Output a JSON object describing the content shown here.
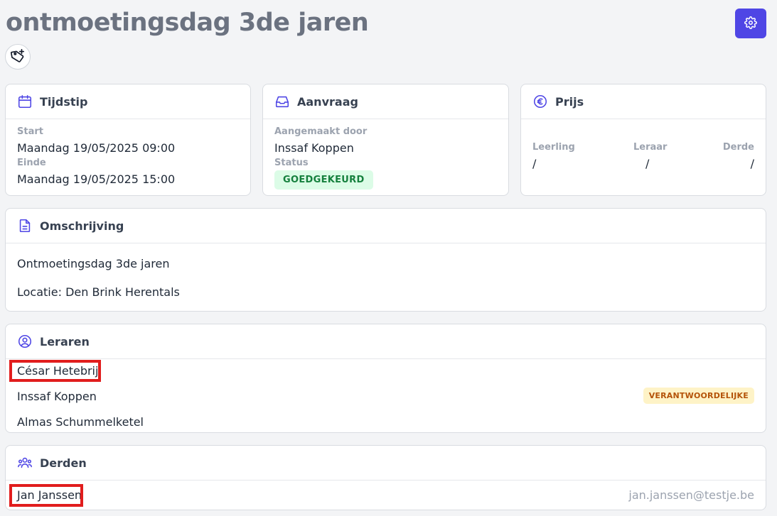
{
  "page": {
    "title": "ontmoetingsdag 3de jaren"
  },
  "tijdstip": {
    "title": "Tijdstip",
    "start_label": "Start",
    "start_value": "Maandag 19/05/2025 09:00",
    "end_label": "Einde",
    "end_value": "Maandag 19/05/2025 15:00"
  },
  "aanvraag": {
    "title": "Aanvraag",
    "created_by_label": "Aangemaakt door",
    "created_by_value": "Inssaf Koppen",
    "status_label": "Status",
    "status_value": "GOEDGEKEURD"
  },
  "prijs": {
    "title": "Prijs",
    "columns": [
      {
        "label": "Leerling",
        "value": "/"
      },
      {
        "label": "Leraar",
        "value": "/"
      },
      {
        "label": "Derde",
        "value": "/"
      }
    ]
  },
  "omschrijving": {
    "title": "Omschrijving",
    "lines": [
      "Ontmoetingsdag 3de jaren",
      "Locatie: Den Brink Herentals"
    ]
  },
  "leraren": {
    "title": "Leraren",
    "items": [
      {
        "name": "César Hetebrij",
        "badge": ""
      },
      {
        "name": "Inssaf Koppen",
        "badge": "VERANTWOORDELIJKE"
      },
      {
        "name": "Almas Schummelketel",
        "badge": ""
      }
    ]
  },
  "derden": {
    "title": "Derden",
    "items": [
      {
        "name": "Jan Janssen",
        "email": "jan.janssen@testje.be"
      }
    ]
  },
  "colors": {
    "accent": "#4f46e5",
    "highlight": "#e11d1d",
    "status_green": "#15803d",
    "badge_yellow": "#b45309"
  },
  "icons": [
    "settings-gear-icon",
    "tag-add-icon",
    "calendar-icon",
    "inbox-icon",
    "euro-icon",
    "document-icon",
    "user-circle-icon",
    "users-group-icon"
  ]
}
